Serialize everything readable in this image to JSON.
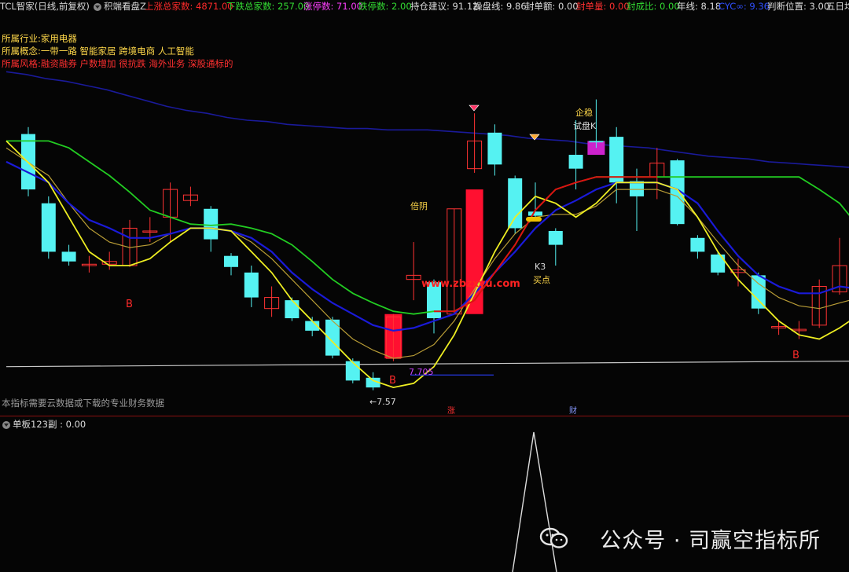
{
  "header": {
    "segments": [
      {
        "id": "stock",
        "text": "TCL智家(日线,前复权)",
        "color": "#d8d8d8"
      },
      {
        "id": "indicator",
        "text": "积端看盘Z",
        "color": "#d8d8d8"
      },
      {
        "id": "up-total",
        "text": "上涨总家数: 4871.00",
        "color": "#ff2a2a"
      },
      {
        "id": "down-total",
        "text": "下跌总家数: 257.00",
        "color": "#33dd33"
      },
      {
        "id": "limit-up",
        "text": "涨停数: 71.00",
        "color": "#ff40ff"
      },
      {
        "id": "limit-down",
        "text": "跌停数: 2.00",
        "color": "#33dd33"
      },
      {
        "id": "position",
        "text": "持仓建议: 91.12",
        "color": "#dddddd"
      },
      {
        "id": "op-line",
        "text": "操盘线: 9.86",
        "color": "#dddddd"
      },
      {
        "id": "seal-amount",
        "text": "封单额: 0.00",
        "color": "#dddddd"
      },
      {
        "id": "seal-volume",
        "text": "封单量: 0.00",
        "color": "#ff3030"
      },
      {
        "id": "seal-ratio",
        "text": "封成比: 0.00",
        "color": "#33dd33"
      },
      {
        "id": "year-line",
        "text": "年线: 8.18",
        "color": "#dddddd"
      },
      {
        "id": "cyc",
        "text": "CYC∞: 9.36",
        "color": "#3050ff"
      },
      {
        "id": "judge",
        "text": "判断位置: 3.00",
        "color": "#dddddd"
      },
      {
        "id": "five-day",
        "text": "五日均",
        "color": "#dddddd"
      }
    ]
  },
  "info": {
    "industry_label": "所属行业:",
    "industry_value": "家用电器",
    "concept_label": "所属概念:",
    "concept_value": "一带一路 智能家居 跨境电商 人工智能",
    "style_label": "所属风格:",
    "style_value": "融资融券 户数增加 很抗跌 海外业务 深股通标的"
  },
  "labels": {
    "b1": "B",
    "b2": "B",
    "b3": "B",
    "double_yin": "倍阴",
    "qiwen": "企稳",
    "test_k": "试盘K",
    "k3": "K3",
    "buy_point": "买点",
    "low_price": "←7.57",
    "support": "7.705",
    "site_watermark": "www.zbzxyu.com",
    "data_notice": "本指标需要云数据或下载的专业财务数据",
    "tag_zhang": "涨",
    "tag_cai": "财"
  },
  "bottom_panel": {
    "title": "单板123副 : 0.00"
  },
  "watermark": "公众号 · 司赢空指标所",
  "colors": {
    "up": "#ff3333",
    "down": "#55f2f2",
    "white_line": "#c8c8c8",
    "green_line": "#22cc22",
    "blue_line": "#1a1ad8",
    "yellow_line": "#eeee22",
    "tan_line": "#b89c36",
    "red_line": "#dd1111",
    "navy_line": "#1a1a9a"
  },
  "chart_data": {
    "type": "candlestick",
    "candles": [
      {
        "o": 9.4,
        "c": 9.0,
        "h": 9.45,
        "l": 8.95
      },
      {
        "o": 8.9,
        "c": 8.55,
        "h": 8.95,
        "l": 8.5
      },
      {
        "o": 8.55,
        "c": 8.48,
        "h": 8.6,
        "l": 8.45
      },
      {
        "o": 8.45,
        "c": 8.46,
        "h": 8.52,
        "l": 8.4
      },
      {
        "o": 8.46,
        "c": 8.48,
        "h": 8.55,
        "l": 8.42
      },
      {
        "o": 8.45,
        "c": 8.72,
        "h": 8.78,
        "l": 8.44
      },
      {
        "o": 8.7,
        "c": 8.7,
        "h": 8.8,
        "l": 8.62
      },
      {
        "o": 8.8,
        "c": 9.0,
        "h": 9.05,
        "l": 8.62
      },
      {
        "o": 8.92,
        "c": 8.96,
        "h": 9.02,
        "l": 8.88
      },
      {
        "o": 8.86,
        "c": 8.64,
        "h": 8.88,
        "l": 8.55
      },
      {
        "o": 8.52,
        "c": 8.44,
        "h": 8.54,
        "l": 8.38
      },
      {
        "o": 8.4,
        "c": 8.22,
        "h": 8.45,
        "l": 8.15
      },
      {
        "o": 8.14,
        "c": 8.22,
        "h": 8.3,
        "l": 8.08
      },
      {
        "o": 8.2,
        "c": 8.07,
        "h": 8.22,
        "l": 8.05
      },
      {
        "o": 8.05,
        "c": 7.98,
        "h": 8.08,
        "l": 7.94
      },
      {
        "o": 8.06,
        "c": 7.8,
        "h": 8.08,
        "l": 7.78
      },
      {
        "o": 7.76,
        "c": 7.62,
        "h": 7.78,
        "l": 7.6
      },
      {
        "o": 7.64,
        "c": 7.57,
        "h": 7.68,
        "l": 7.55
      },
      {
        "o": 7.78,
        "c": 8.08,
        "h": 8.1,
        "l": 7.76
      },
      {
        "o": 8.35,
        "c": 8.38,
        "h": 8.62,
        "l": 8.2
      },
      {
        "o": 8.33,
        "c": 8.07,
        "h": 8.35,
        "l": 7.96
      },
      {
        "o": 8.1,
        "c": 8.86,
        "h": 8.86,
        "l": 8.1
      },
      {
        "o": 9.15,
        "c": 9.35,
        "h": 9.55,
        "l": 9.12
      },
      {
        "o": 9.41,
        "c": 9.18,
        "h": 9.47,
        "l": 9.1
      },
      {
        "o": 9.08,
        "c": 8.72,
        "h": 9.1,
        "l": 8.68
      },
      {
        "o": 8.84,
        "c": 8.81,
        "h": 9.05,
        "l": 8.77
      },
      {
        "o": 8.7,
        "c": 8.6,
        "h": 8.72,
        "l": 8.45
      },
      {
        "o": 9.25,
        "c": 9.15,
        "h": 9.5,
        "l": 9.0
      },
      {
        "o": 9.35,
        "c": 9.34,
        "h": 9.65,
        "l": 9.3
      },
      {
        "o": 9.38,
        "c": 9.05,
        "h": 9.45,
        "l": 8.9
      },
      {
        "o": 9.06,
        "c": 8.95,
        "h": 9.15,
        "l": 8.7
      },
      {
        "o": 9.09,
        "c": 9.19,
        "h": 9.3,
        "l": 8.93
      },
      {
        "o": 9.21,
        "c": 8.75,
        "h": 9.22,
        "l": 8.74
      },
      {
        "o": 8.65,
        "c": 8.55,
        "h": 8.67,
        "l": 8.5
      },
      {
        "o": 8.53,
        "c": 8.4,
        "h": 8.55,
        "l": 8.38
      },
      {
        "o": 8.4,
        "c": 8.42,
        "h": 8.5,
        "l": 8.3
      },
      {
        "o": 8.38,
        "c": 8.14,
        "h": 8.4,
        "l": 8.1
      },
      {
        "o": 8.0,
        "c": 8.01,
        "h": 8.05,
        "l": 7.95
      },
      {
        "o": 7.98,
        "c": 7.99,
        "h": 8.05,
        "l": 7.92
      },
      {
        "o": 8.02,
        "c": 8.3,
        "h": 8.35,
        "l": 8.0
      },
      {
        "o": 8.26,
        "c": 8.45,
        "h": 8.65,
        "l": 8.24
      },
      {
        "o": 8.45,
        "c": 8.1,
        "h": 8.48,
        "l": 8.02
      },
      {
        "o": 8.1,
        "c": 8.14,
        "h": 8.6,
        "l": 8.08
      }
    ],
    "volume_bars": [
      {
        "i": 18,
        "top": 8.1,
        "bottom": 7.78,
        "color": "red"
      },
      {
        "i": 22,
        "top": 9.0,
        "bottom": 8.1,
        "color": "red"
      },
      {
        "i": 28,
        "top": 9.35,
        "bottom": 9.25,
        "color": "magenta"
      }
    ],
    "lines": {
      "green": [
        9.35,
        9.35,
        9.3,
        9.2,
        9.1,
        8.98,
        8.85,
        8.8,
        8.75,
        8.74,
        8.75,
        8.72,
        8.68,
        8.6,
        8.48,
        8.35,
        8.25,
        8.18,
        8.12,
        8.1,
        8.12,
        8.12,
        8.2,
        8.4,
        8.6,
        8.85,
        9.0,
        9.05,
        9.09,
        9.09,
        9.09,
        9.09,
        9.09,
        9.09,
        9.09,
        9.09,
        9.09,
        9.09,
        9.09,
        9.0,
        8.9,
        8.72,
        8.55
      ],
      "blue": [
        9.2,
        9.05,
        8.9,
        8.78,
        8.72,
        8.65,
        8.65,
        8.68,
        8.72,
        8.72,
        8.7,
        8.65,
        8.55,
        8.4,
        8.28,
        8.18,
        8.1,
        8.02,
        7.98,
        8.0,
        8.05,
        8.1,
        8.25,
        8.4,
        8.55,
        8.72,
        8.85,
        8.92,
        9.0,
        9.05,
        9.05,
        9.05,
        9.0,
        8.9,
        8.7,
        8.52,
        8.38,
        8.3,
        8.25,
        8.25,
        8.3,
        8.28,
        8.2
      ],
      "yellow": [
        9.35,
        9.05,
        8.8,
        8.55,
        8.45,
        8.45,
        8.5,
        8.62,
        8.72,
        8.72,
        8.7,
        8.55,
        8.4,
        8.2,
        8.05,
        7.9,
        7.75,
        7.62,
        7.57,
        7.6,
        7.72,
        7.95,
        8.25,
        8.55,
        8.8,
        8.95,
        8.9,
        8.8,
        8.9,
        9.05,
        9.05,
        9.05,
        9.0,
        8.8,
        8.55,
        8.35,
        8.2,
        8.05,
        7.95,
        7.92,
        8.0,
        8.1,
        8.08
      ],
      "tan": [
        9.3,
        9.1,
        8.9,
        8.72,
        8.62,
        8.58,
        8.6,
        8.68,
        8.72,
        8.72,
        8.7,
        8.62,
        8.5,
        8.35,
        8.2,
        8.05,
        7.92,
        7.84,
        7.78,
        7.8,
        7.88,
        8.05,
        8.28,
        8.5,
        8.68,
        8.8,
        8.82,
        8.82,
        8.88,
        9.0,
        9.0,
        9.0,
        8.95,
        8.8,
        8.62,
        8.45,
        8.32,
        8.22,
        8.16,
        8.14,
        8.18,
        8.22,
        8.2
      ],
      "white": {
        "from": 7.72,
        "to": 7.76
      },
      "navy": [
        9.85,
        9.83,
        9.8,
        9.78,
        9.75,
        9.72,
        9.68,
        9.64,
        9.6,
        9.57,
        9.55,
        9.52,
        9.5,
        9.49,
        9.47,
        9.46,
        9.45,
        9.44,
        9.44,
        9.43,
        9.43,
        9.43,
        9.42,
        9.41,
        9.4,
        9.39,
        9.37,
        9.36,
        9.35,
        9.33,
        9.32,
        9.31,
        9.3,
        9.28,
        9.26,
        9.24,
        9.23,
        9.22,
        9.2,
        9.19,
        9.18,
        9.17,
        9.16
      ]
    },
    "support_price": 7.705,
    "low_marker": 7.57
  }
}
